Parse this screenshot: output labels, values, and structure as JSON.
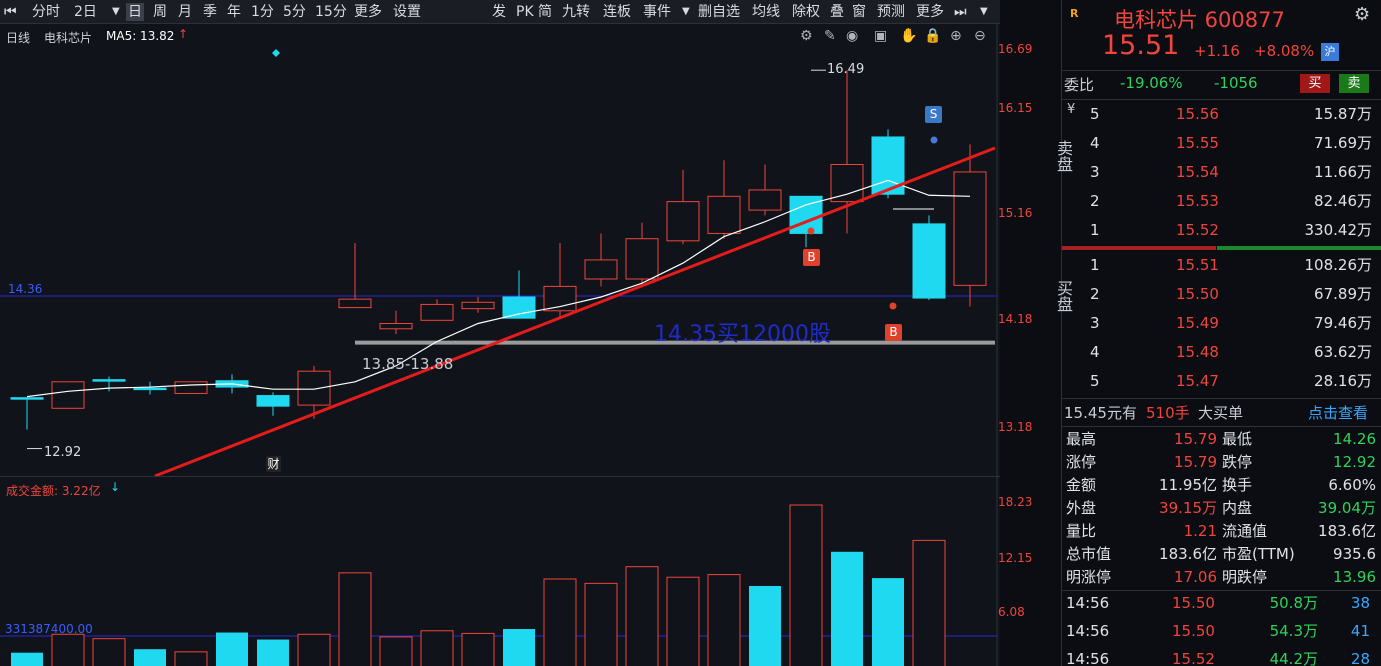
{
  "toolbar": {
    "items_left": [
      "分时",
      "2日",
      "日",
      "周",
      "月",
      "季",
      "年",
      "1分",
      "5分",
      "15分",
      "更多",
      "设置"
    ],
    "items_right": [
      "发",
      "PK",
      "简",
      "九转",
      "连板",
      "事件",
      "删自选",
      "均线",
      "除权",
      "叠",
      "窗",
      "预测",
      "更多"
    ]
  },
  "chart": {
    "period_label": "日线",
    "name_label": "电科芯片",
    "ma_label": "MA5: 13.82",
    "y_labels": [
      "16.69",
      "16.15",
      "15.16",
      "14.18",
      "13.18"
    ],
    "hline_label": "14.36",
    "high_label": "16.49",
    "low_label": "12.92",
    "support_label": "13.85-13.88",
    "annotation": "14.35买12000股",
    "signal_s": "S",
    "signal_b1": "B",
    "signal_b2": "B",
    "fin_badge": "财",
    "vol_label": "成交金额: 3.22亿",
    "vol_y_labels": [
      "18.23",
      "12.15",
      "6.08"
    ],
    "vol_hline_label": "331387400.00"
  },
  "chart_data": {
    "type": "candlestick",
    "title": "电科芯片 日线",
    "ylim": [
      12.8,
      16.8
    ],
    "candles": [
      {
        "o": 13.4,
        "c": 13.4,
        "h": 13.4,
        "l": 13.1,
        "dir": "flat"
      },
      {
        "o": 13.3,
        "c": 13.55,
        "h": 13.55,
        "l": 13.3,
        "dir": "up"
      },
      {
        "o": 13.57,
        "c": 13.57,
        "h": 13.6,
        "l": 13.46,
        "dir": "flat"
      },
      {
        "o": 13.49,
        "c": 13.49,
        "h": 13.55,
        "l": 13.43,
        "dir": "flat"
      },
      {
        "o": 13.44,
        "c": 13.55,
        "h": 13.55,
        "l": 13.44,
        "dir": "up"
      },
      {
        "o": 13.56,
        "c": 13.5,
        "h": 13.62,
        "l": 13.44,
        "dir": "down"
      },
      {
        "o": 13.42,
        "c": 13.32,
        "h": 13.45,
        "l": 13.23,
        "dir": "down"
      },
      {
        "o": 13.33,
        "c": 13.65,
        "h": 13.7,
        "l": 13.2,
        "dir": "up"
      },
      {
        "o": 14.25,
        "c": 14.33,
        "h": 14.86,
        "l": 14.25,
        "dir": "up"
      },
      {
        "o": 14.05,
        "c": 14.1,
        "h": 14.22,
        "l": 14.0,
        "dir": "up"
      },
      {
        "o": 14.13,
        "c": 14.28,
        "h": 14.33,
        "l": 14.13,
        "dir": "up"
      },
      {
        "o": 14.24,
        "c": 14.3,
        "h": 14.35,
        "l": 14.2,
        "dir": "up"
      },
      {
        "o": 14.35,
        "c": 14.15,
        "h": 14.6,
        "l": 14.15,
        "dir": "down"
      },
      {
        "o": 14.22,
        "c": 14.45,
        "h": 14.86,
        "l": 14.15,
        "dir": "up"
      },
      {
        "o": 14.52,
        "c": 14.7,
        "h": 14.95,
        "l": 14.45,
        "dir": "up"
      },
      {
        "o": 14.52,
        "c": 14.9,
        "h": 15.05,
        "l": 14.45,
        "dir": "up"
      },
      {
        "o": 14.88,
        "c": 15.25,
        "h": 15.55,
        "l": 14.85,
        "dir": "up"
      },
      {
        "o": 14.95,
        "c": 15.3,
        "h": 15.64,
        "l": 14.9,
        "dir": "up"
      },
      {
        "o": 15.17,
        "c": 15.36,
        "h": 15.6,
        "l": 15.12,
        "dir": "up"
      },
      {
        "o": 15.3,
        "c": 14.95,
        "h": 15.3,
        "l": 14.82,
        "dir": "down"
      },
      {
        "o": 15.25,
        "c": 15.6,
        "h": 16.49,
        "l": 14.95,
        "dir": "up"
      },
      {
        "o": 15.86,
        "c": 15.32,
        "h": 15.93,
        "l": 15.28,
        "dir": "down"
      },
      {
        "o": 15.04,
        "c": 14.34,
        "h": 15.12,
        "l": 14.32,
        "dir": "down"
      },
      {
        "o": 14.46,
        "c": 15.53,
        "h": 15.79,
        "l": 14.26,
        "dir": "up"
      }
    ],
    "ma5": [
      13.41,
      13.46,
      13.49,
      13.5,
      13.52,
      13.53,
      13.48,
      13.48,
      13.55,
      13.7,
      13.93,
      14.1,
      14.19,
      14.26,
      14.35,
      14.48,
      14.67,
      14.92,
      15.06,
      15.22,
      15.32,
      15.45,
      15.31,
      15.3
    ],
    "volume": [
      {
        "v": 1.4,
        "dir": "down"
      },
      {
        "v": 3.5,
        "dir": "up"
      },
      {
        "v": 3.0,
        "dir": "up"
      },
      {
        "v": 1.8,
        "dir": "down"
      },
      {
        "v": 1.5,
        "dir": "up"
      },
      {
        "v": 3.7,
        "dir": "down"
      },
      {
        "v": 2.9,
        "dir": "down"
      },
      {
        "v": 3.5,
        "dir": "up"
      },
      {
        "v": 10.5,
        "dir": "up"
      },
      {
        "v": 3.2,
        "dir": "up"
      },
      {
        "v": 3.9,
        "dir": "up"
      },
      {
        "v": 3.6,
        "dir": "up"
      },
      {
        "v": 4.1,
        "dir": "down"
      },
      {
        "v": 9.8,
        "dir": "up"
      },
      {
        "v": 9.3,
        "dir": "up"
      },
      {
        "v": 11.2,
        "dir": "up"
      },
      {
        "v": 10.0,
        "dir": "up"
      },
      {
        "v": 10.3,
        "dir": "up"
      },
      {
        "v": 9.0,
        "dir": "down"
      },
      {
        "v": 18.23,
        "dir": "up"
      },
      {
        "v": 12.9,
        "dir": "down"
      },
      {
        "v": 9.9,
        "dir": "down"
      },
      {
        "v": 14.2,
        "dir": "up"
      },
      {
        "v": 0,
        "dir": "none"
      }
    ],
    "volume_ylim": [
      0,
      20
    ]
  },
  "quote": {
    "name_code": "电科芯片 600877",
    "price": "15.51",
    "change": "+1.16",
    "change_pct": "+8.08%",
    "market_badge": "沪",
    "weibi_label": "委比",
    "weibi_pct": "-19.06%",
    "weibi_diff": "-1056",
    "buy_btn": "买",
    "sell_btn": "卖",
    "sell_group_label": "卖盘",
    "buy_group_label": "买盘",
    "asks": [
      {
        "lvl": "5",
        "price": "15.56",
        "vol": "15.87万"
      },
      {
        "lvl": "4",
        "price": "15.55",
        "vol": "71.69万"
      },
      {
        "lvl": "3",
        "price": "15.54",
        "vol": "11.66万"
      },
      {
        "lvl": "2",
        "price": "15.53",
        "vol": "82.46万"
      },
      {
        "lvl": "1",
        "price": "15.52",
        "vol": "330.42万"
      }
    ],
    "bids": [
      {
        "lvl": "1",
        "price": "15.51",
        "vol": "108.26万"
      },
      {
        "lvl": "2",
        "price": "15.50",
        "vol": "67.89万"
      },
      {
        "lvl": "3",
        "price": "15.49",
        "vol": "79.46万"
      },
      {
        "lvl": "4",
        "price": "15.48",
        "vol": "63.62万"
      },
      {
        "lvl": "5",
        "price": "15.47",
        "vol": "28.16万"
      }
    ],
    "bigorder_text": "15.45元有",
    "bigorder_hands": "510手",
    "bigorder_label": "大买单",
    "bigorder_link": "点击查看",
    "stats": [
      {
        "k1": "最高",
        "v1": "15.79",
        "c1": "red",
        "k2": "最低",
        "v2": "14.26",
        "c2": "green"
      },
      {
        "k1": "涨停",
        "v1": "15.79",
        "c1": "red",
        "k2": "跌停",
        "v2": "12.92",
        "c2": "green"
      },
      {
        "k1": "金额",
        "v1": "11.95亿",
        "c1": "white",
        "k2": "换手",
        "v2": "6.60%",
        "c2": "white"
      },
      {
        "k1": "外盘",
        "v1": "39.15万",
        "c1": "red",
        "k2": "内盘",
        "v2": "39.04万",
        "c2": "green"
      },
      {
        "k1": "量比",
        "v1": "1.21",
        "c1": "red",
        "k2": "流通值",
        "v2": "183.6亿",
        "c2": "white"
      },
      {
        "k1": "总市值",
        "v1": "183.6亿",
        "c1": "white",
        "k2": "市盈(TTM)",
        "v2": "935.6",
        "c2": "white"
      },
      {
        "k1": "明涨停",
        "v1": "17.06",
        "c1": "red",
        "k2": "明跌停",
        "v2": "13.96",
        "c2": "green"
      }
    ],
    "ticks": [
      {
        "time": "14:56",
        "price": "15.50",
        "vol": "50.8万",
        "n": "38"
      },
      {
        "time": "14:56",
        "price": "15.50",
        "vol": "54.3万",
        "n": "41"
      },
      {
        "time": "14:56",
        "price": "15.52",
        "vol": "44.2万",
        "n": "28"
      }
    ]
  },
  "colors": {
    "up": "#f0453c",
    "down": "#1fd9f0",
    "ma": "#ffffff",
    "trend": "#e41c1c",
    "hline": "#2a2ad8"
  }
}
